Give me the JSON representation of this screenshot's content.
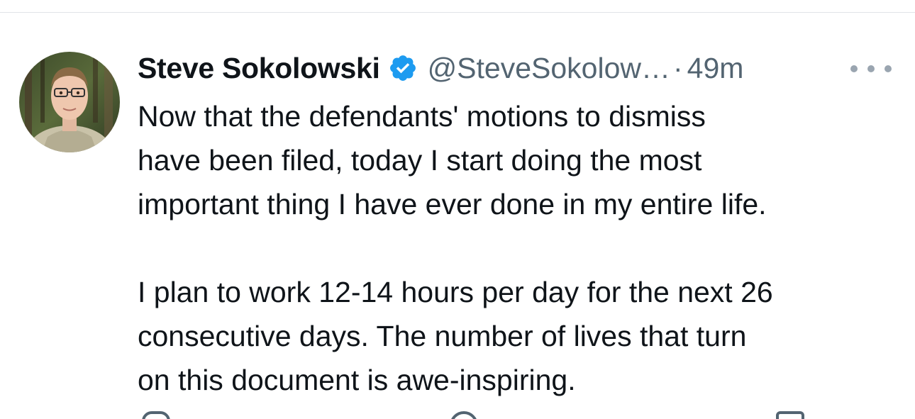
{
  "tweet": {
    "display_name": "Steve Sokolowski",
    "handle": "@SteveSokolow…",
    "separator": "·",
    "time": "49m",
    "verified": true,
    "paragraphs": [
      [
        "Now that the defendants' motions to dismiss",
        "have been filed, today I start doing the most",
        "important thing I have ever done in my entire life."
      ],
      [
        "I plan to work 12-14 hours per day for the next 26",
        "consecutive days.  The number of lives that turn",
        "on this document is awe-inspiring."
      ]
    ]
  },
  "icons": {
    "verified": "verified-badge-icon",
    "more": "more-options-icon",
    "reply": "reply-icon",
    "retweet": "retweet-icon",
    "like": "like-icon",
    "views": "views-icon",
    "bookmark": "bookmark-icon",
    "share": "share-icon"
  },
  "colors": {
    "accent": "#1d9bf0",
    "text": "#0f1419",
    "muted": "#536471",
    "divider": "#e1e4e8"
  }
}
